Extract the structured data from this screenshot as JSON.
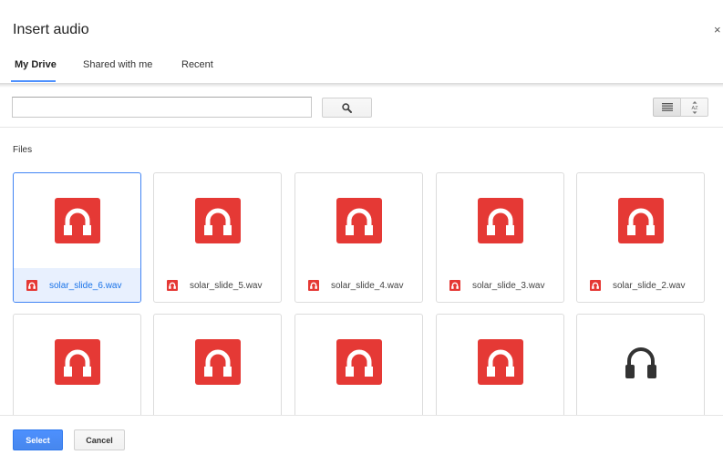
{
  "dialog": {
    "title": "Insert audio",
    "close_label": "×"
  },
  "tabs": [
    {
      "label": "My Drive",
      "active": true
    },
    {
      "label": "Shared with me",
      "active": false
    },
    {
      "label": "Recent",
      "active": false
    }
  ],
  "toolbar": {
    "search_value": "",
    "search_placeholder": "",
    "search_icon": "magnifier-icon",
    "list_view_icon": "list-view-icon",
    "sort_icon": "sort-az-icon",
    "sort_label": "AZ"
  },
  "files": {
    "section_label": "Files",
    "items": [
      {
        "name": "solar_slide_6.wav",
        "icon": "audio-file-icon",
        "selected": true
      },
      {
        "name": "solar_slide_5.wav",
        "icon": "audio-file-icon",
        "selected": false
      },
      {
        "name": "solar_slide_4.wav",
        "icon": "audio-file-icon",
        "selected": false
      },
      {
        "name": "solar_slide_3.wav",
        "icon": "audio-file-icon",
        "selected": false
      },
      {
        "name": "solar_slide_2.wav",
        "icon": "audio-file-icon",
        "selected": false
      },
      {
        "name": "",
        "icon": "audio-file-icon",
        "selected": false
      },
      {
        "name": "",
        "icon": "audio-file-icon",
        "selected": false
      },
      {
        "name": "",
        "icon": "audio-file-icon",
        "selected": false
      },
      {
        "name": "",
        "icon": "audio-file-icon",
        "selected": false
      },
      {
        "name": "",
        "icon": "headphones-icon",
        "selected": false
      }
    ]
  },
  "footer": {
    "select_label": "Select",
    "cancel_label": "Cancel"
  },
  "colors": {
    "accent": "#4d90fe",
    "audio_icon": "#e53935",
    "selected_bg": "#e8f0fe"
  }
}
